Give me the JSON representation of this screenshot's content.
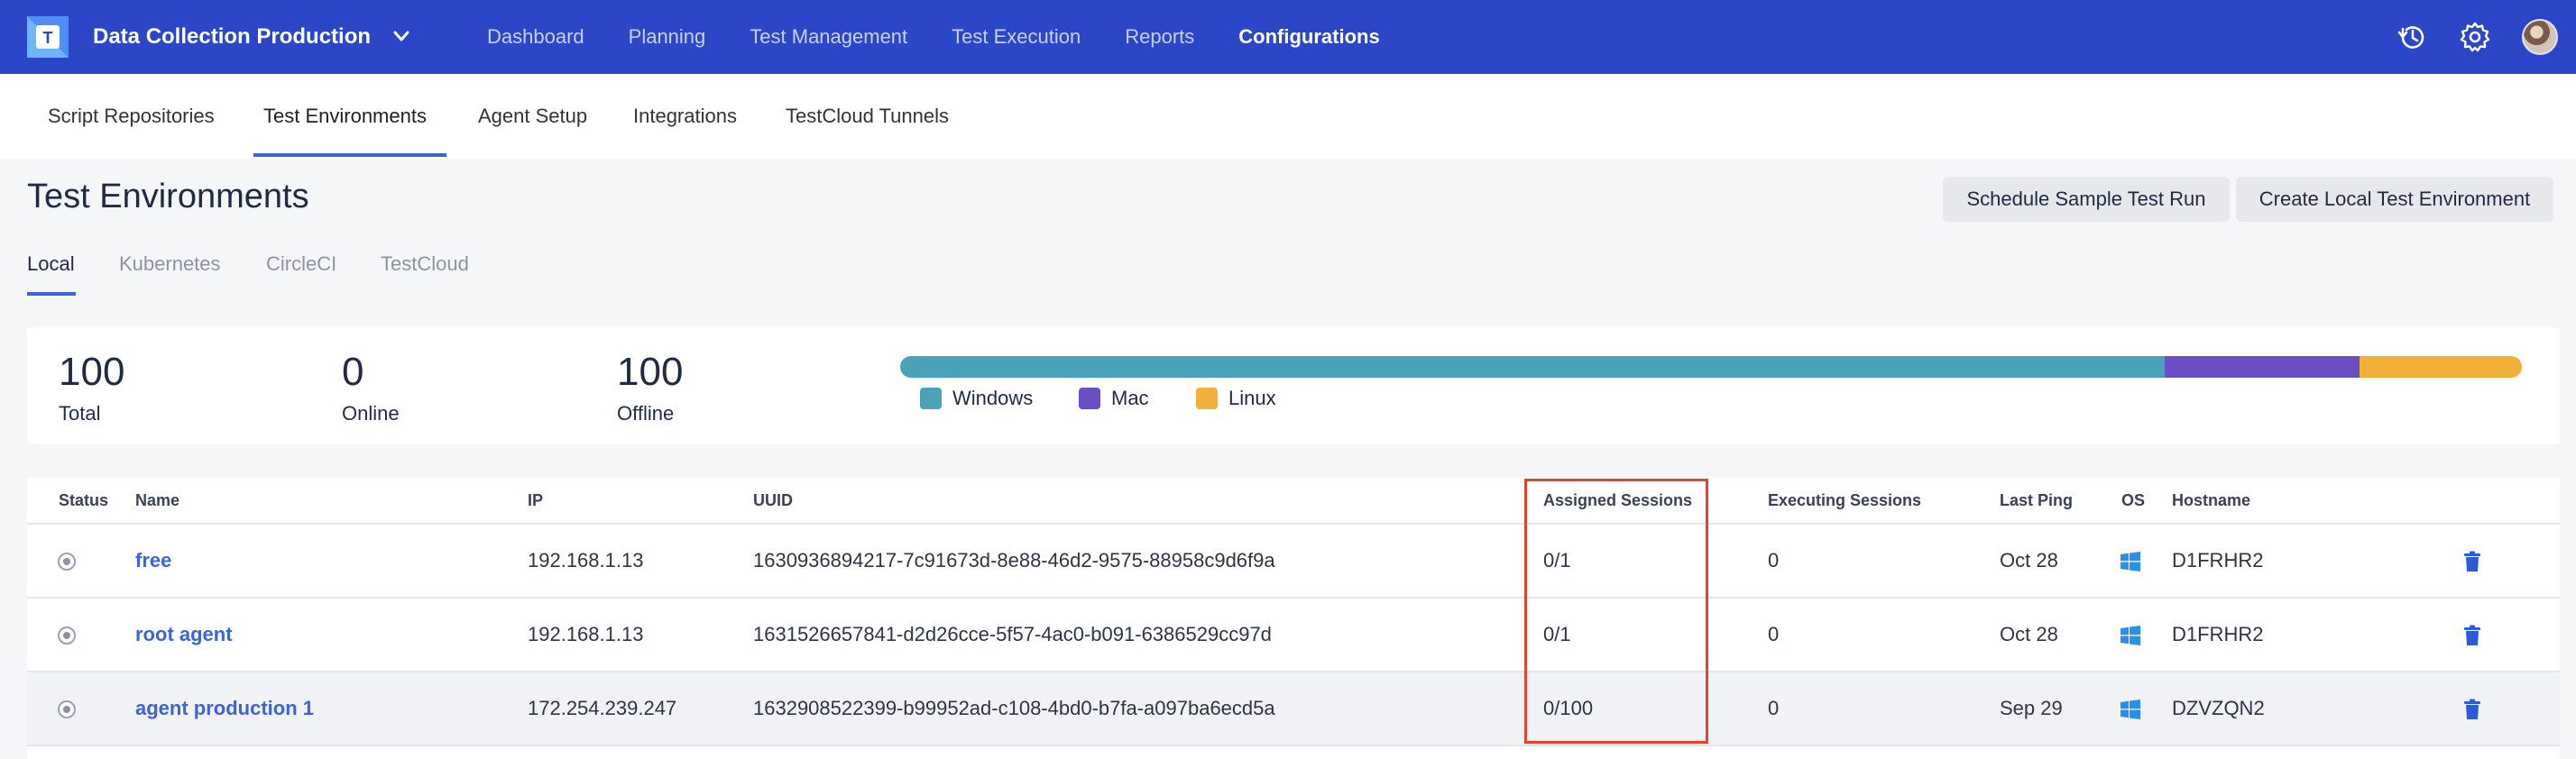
{
  "topbar": {
    "project_name": "Data Collection Production",
    "nav": [
      "Dashboard",
      "Planning",
      "Test Management",
      "Test Execution",
      "Reports",
      "Configurations"
    ],
    "active_nav": "Configurations",
    "icons": [
      "history-icon",
      "settings-icon",
      "avatar"
    ]
  },
  "subnav": {
    "items": [
      "Script Repositories",
      "Test Environments",
      "Agent Setup",
      "Integrations",
      "TestCloud Tunnels"
    ],
    "active": "Test Environments"
  },
  "page": {
    "title": "Test Environments",
    "schedule_button": "Schedule Sample Test Run",
    "create_button": "Create Local Test Environment"
  },
  "env_tabs": {
    "items": [
      "Local",
      "Kubernetes",
      "CircleCI",
      "TestCloud"
    ],
    "active": "Local"
  },
  "stats": {
    "total_value": "100",
    "total_label": "Total",
    "online_value": "0",
    "online_label": "Online",
    "offline_value": "100",
    "offline_label": "Offline",
    "os_distribution": [
      {
        "name": "Windows",
        "fraction": 0.78,
        "color": "#4aa3b8"
      },
      {
        "name": "Mac",
        "fraction": 0.12,
        "color": "#6a4fc4"
      },
      {
        "name": "Linux",
        "fraction": 0.1,
        "color": "#f2b03a"
      }
    ]
  },
  "table": {
    "headers": {
      "status": "Status",
      "name": "Name",
      "ip": "IP",
      "uuid": "UUID",
      "assigned": "Assigned Sessions",
      "executing": "Executing Sessions",
      "last_ping": "Last Ping",
      "os": "OS",
      "hostname": "Hostname"
    },
    "rows": [
      {
        "name": "free",
        "ip": "192.168.1.13",
        "uuid": "1630936894217-7c91673d-8e88-46d2-9575-88958c9d6f9a",
        "assigned": "0/1",
        "executing": "0",
        "last_ping": "Oct 28",
        "os": "windows-icon",
        "hostname": "D1FRHR2"
      },
      {
        "name": "root agent",
        "ip": "192.168.1.13",
        "uuid": "1631526657841-d2d26cce-5f57-4ac0-b091-6386529cc97d",
        "assigned": "0/1",
        "executing": "0",
        "last_ping": "Oct 28",
        "os": "windows-icon",
        "hostname": "D1FRHR2"
      },
      {
        "name": "agent production 1",
        "ip": "172.254.239.247",
        "uuid": "1632908522399-b99952ad-c108-4bd0-b7fa-a097ba6ecd5a",
        "assigned": "0/100",
        "executing": "0",
        "last_ping": "Sep 29",
        "os": "windows-icon",
        "hostname": "DZVZQN2"
      }
    ]
  },
  "colors": {
    "topbar": "#2b46c6",
    "accent": "#3c63d8",
    "highlight": "#e0432f"
  }
}
